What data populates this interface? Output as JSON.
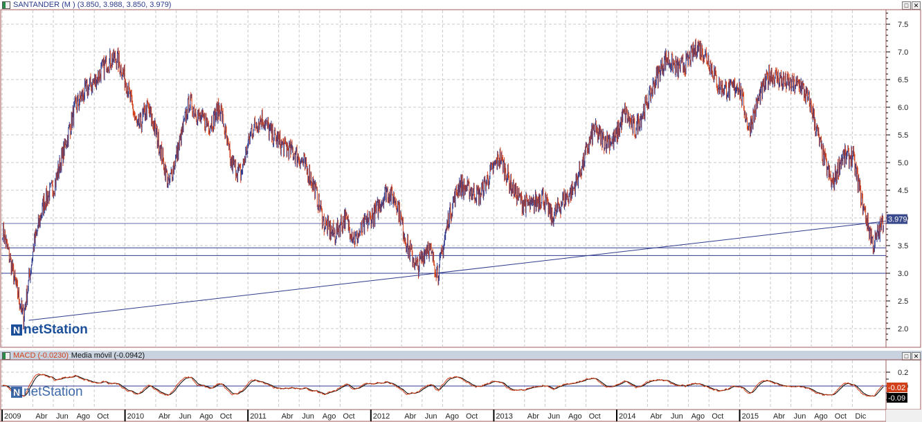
{
  "title_bar": {
    "instrument": "SANTANDER (M )",
    "ohlc": "(3.850, 3.988, 3.850, 3.979)"
  },
  "macd_bar": {
    "macd_label": "MACD (-0.0230)",
    "separator": " - ",
    "signal_label": "Media móvil (-0.0942)"
  },
  "logo_text": "netStation",
  "buttons": {
    "maximize": "□",
    "close": "✕"
  },
  "colors": {
    "up": "#2e3a8c",
    "down": "#d2401a",
    "macd": "#d2401a",
    "signal": "#000000",
    "lines": "#2e3a8c"
  },
  "chart_data": [
    {
      "type": "bar",
      "subtype": "ohlc",
      "title": "SANTANDER (M )",
      "ylim": [
        1.75,
        7.75
      ],
      "y_ticks": [
        "7.5",
        "7.0",
        "6.5",
        "6.0",
        "5.5",
        "5.0",
        "4.5",
        "4.0",
        "3.5",
        "3.0",
        "2.5",
        "2.0"
      ],
      "last_value": "3.979",
      "grid": true,
      "monthly_close": [
        [
          "2009-01",
          3.8
        ],
        [
          "2009-02",
          3.0
        ],
        [
          "2009-03",
          2.2
        ],
        [
          "2009-04",
          3.5
        ],
        [
          "2009-05",
          4.3
        ],
        [
          "2009-06",
          4.6
        ],
        [
          "2009-07",
          5.3
        ],
        [
          "2009-08",
          6.0
        ],
        [
          "2009-09",
          6.3
        ],
        [
          "2009-10",
          6.5
        ],
        [
          "2009-11",
          6.8
        ],
        [
          "2009-12",
          6.9
        ],
        [
          "2010-01",
          6.4
        ],
        [
          "2010-02",
          5.6
        ],
        [
          "2010-03",
          6.0
        ],
        [
          "2010-04",
          5.4
        ],
        [
          "2010-05",
          4.6
        ],
        [
          "2010-06",
          5.3
        ],
        [
          "2010-07",
          6.1
        ],
        [
          "2010-08",
          5.8
        ],
        [
          "2010-09",
          5.7
        ],
        [
          "2010-10",
          6.0
        ],
        [
          "2010-11",
          5.0
        ],
        [
          "2010-12",
          4.8
        ],
        [
          "2011-01",
          5.6
        ],
        [
          "2011-02",
          5.8
        ],
        [
          "2011-03",
          5.5
        ],
        [
          "2011-04",
          5.3
        ],
        [
          "2011-05",
          5.2
        ],
        [
          "2011-06",
          5.0
        ],
        [
          "2011-07",
          4.6
        ],
        [
          "2011-08",
          3.9
        ],
        [
          "2011-09",
          3.7
        ],
        [
          "2011-10",
          4.0
        ],
        [
          "2011-11",
          3.6
        ],
        [
          "2011-12",
          3.9
        ],
        [
          "2012-01",
          4.1
        ],
        [
          "2012-02",
          4.5
        ],
        [
          "2012-03",
          4.3
        ],
        [
          "2012-04",
          3.5
        ],
        [
          "2012-05",
          3.1
        ],
        [
          "2012-06",
          3.5
        ],
        [
          "2012-07",
          3.0
        ],
        [
          "2012-08",
          4.0
        ],
        [
          "2012-09",
          4.6
        ],
        [
          "2012-10",
          4.5
        ],
        [
          "2012-11",
          4.4
        ],
        [
          "2012-12",
          4.8
        ],
        [
          "2013-01",
          5.1
        ],
        [
          "2013-02",
          4.6
        ],
        [
          "2013-03",
          4.3
        ],
        [
          "2013-04",
          4.2
        ],
        [
          "2013-05",
          4.4
        ],
        [
          "2013-06",
          4.0
        ],
        [
          "2013-07",
          4.3
        ],
        [
          "2013-08",
          4.5
        ],
        [
          "2013-09",
          5.0
        ],
        [
          "2013-10",
          5.6
        ],
        [
          "2013-11",
          5.4
        ],
        [
          "2013-12",
          5.4
        ],
        [
          "2014-01",
          5.9
        ],
        [
          "2014-02",
          5.6
        ],
        [
          "2014-03",
          6.0
        ],
        [
          "2014-04",
          6.5
        ],
        [
          "2014-05",
          6.9
        ],
        [
          "2014-06",
          6.7
        ],
        [
          "2014-07",
          6.8
        ],
        [
          "2014-08",
          7.1
        ],
        [
          "2014-09",
          6.9
        ],
        [
          "2014-10",
          6.4
        ],
        [
          "2014-11",
          6.3
        ],
        [
          "2014-12",
          6.4
        ],
        [
          "2015-01",
          5.6
        ],
        [
          "2015-02",
          6.2
        ],
        [
          "2015-03",
          6.6
        ],
        [
          "2015-04",
          6.5
        ],
        [
          "2015-05",
          6.4
        ],
        [
          "2015-06",
          6.4
        ],
        [
          "2015-07",
          6.0
        ],
        [
          "2015-08",
          5.2
        ],
        [
          "2015-09",
          4.6
        ],
        [
          "2015-10",
          5.1
        ],
        [
          "2015-11",
          5.1
        ],
        [
          "2015-12",
          4.2
        ],
        [
          "2016-01",
          3.5
        ],
        [
          "2016-02",
          3.98
        ]
      ],
      "horizontal_levels": [
        3.9,
        3.46,
        3.32,
        3.0
      ],
      "trendline": [
        [
          "2009-03",
          2.15
        ],
        [
          "2012-07",
          3.0
        ]
      ]
    },
    {
      "type": "line",
      "title": "MACD",
      "ylim": [
        -0.35,
        0.35
      ],
      "y_ticks": [
        "0.2",
        "0.0"
      ],
      "series": [
        {
          "name": "MACD",
          "last": "-0.02"
        },
        {
          "name": "Media móvil",
          "last": "-0.09"
        }
      ],
      "zero_line": true
    }
  ],
  "x_axis": {
    "labels": [
      [
        "2009",
        0
      ],
      [
        "Abr",
        3
      ],
      [
        "Jun",
        5
      ],
      [
        "Ago",
        7
      ],
      [
        "Oct",
        9
      ],
      [
        "2010",
        12
      ],
      [
        "Abr",
        15
      ],
      [
        "Jun",
        17
      ],
      [
        "Ago",
        19
      ],
      [
        "Oct",
        21
      ],
      [
        "2011",
        24
      ],
      [
        "Abr",
        27
      ],
      [
        "Jun",
        29
      ],
      [
        "Ago",
        31
      ],
      [
        "Oct",
        33
      ],
      [
        "2012",
        36
      ],
      [
        "Abr",
        39
      ],
      [
        "Jun",
        41
      ],
      [
        "Ago",
        43
      ],
      [
        "Oct",
        45
      ],
      [
        "2013",
        48
      ],
      [
        "Abr",
        51
      ],
      [
        "Jun",
        53
      ],
      [
        "Ago",
        55
      ],
      [
        "Oct",
        57
      ],
      [
        "2014",
        60
      ],
      [
        "Abr",
        63
      ],
      [
        "Jun",
        65
      ],
      [
        "Ago",
        67
      ],
      [
        "Oct",
        69
      ],
      [
        "2015",
        72
      ],
      [
        "Abr",
        75
      ],
      [
        "Jun",
        77
      ],
      [
        "Ago",
        79
      ],
      [
        "Oct",
        81
      ],
      [
        "Dic",
        83
      ]
    ]
  }
}
